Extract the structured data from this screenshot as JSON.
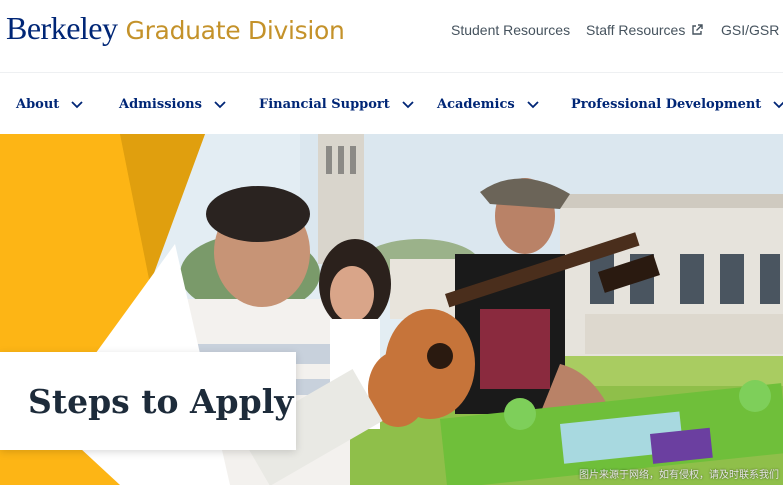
{
  "header": {
    "logo_berkeley": "Berkeley",
    "logo_division": "Graduate Division",
    "utility_links": [
      {
        "label": "Student Resources",
        "external": false
      },
      {
        "label": "Staff Resources",
        "external": true
      },
      {
        "label": "GSI/GSR R",
        "external": false
      }
    ]
  },
  "nav": {
    "items": [
      {
        "label": "About"
      },
      {
        "label": "Admissions"
      },
      {
        "label": "Financial Support"
      },
      {
        "label": "Academics"
      },
      {
        "label": "Professional Development"
      }
    ]
  },
  "hero": {
    "title": "Steps to Apply",
    "watermark": "图片来源于网络，如有侵权，请及时联系我们"
  },
  "colors": {
    "brand_blue": "#002676",
    "brand_gold": "#c4922a",
    "hero_yellow": "#fdb515"
  },
  "icons": [
    "external-link-icon",
    "chevron-down-icon"
  ]
}
